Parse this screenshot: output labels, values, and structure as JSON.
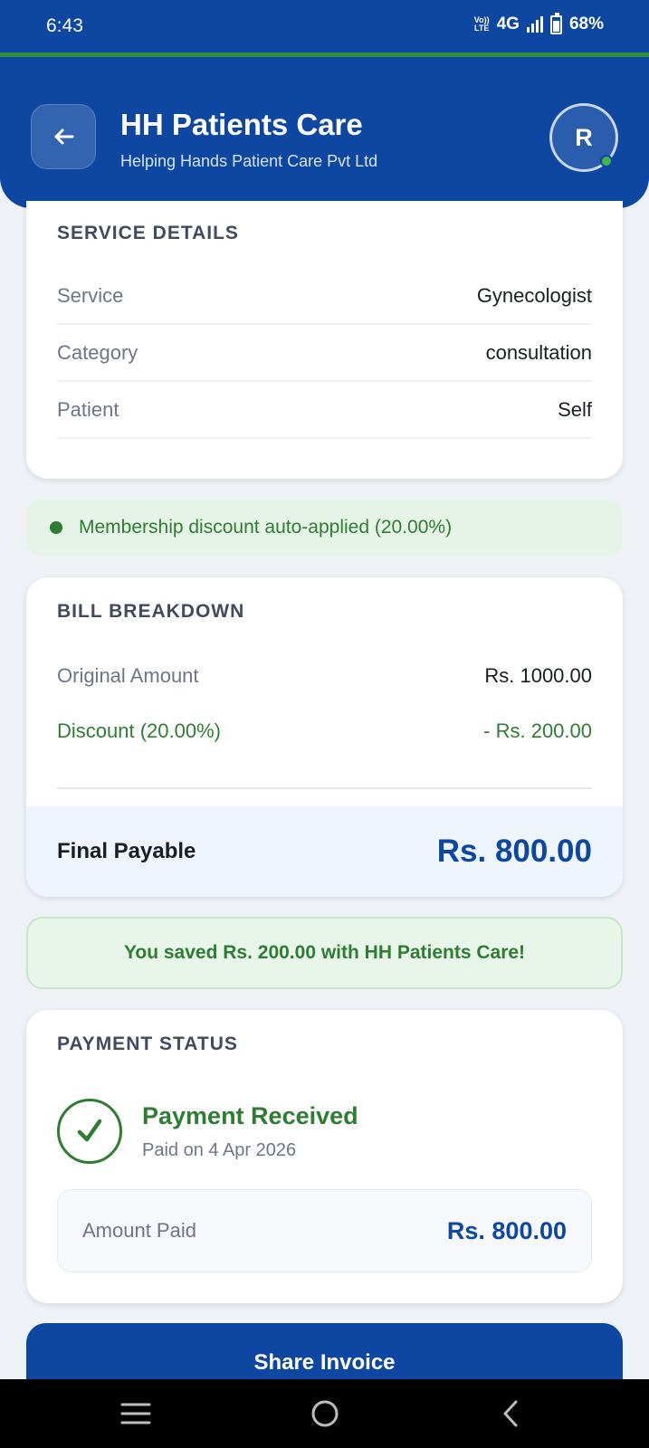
{
  "status_bar": {
    "time": "6:43",
    "volte_top": "Vo))",
    "volte_bottom": "LTE",
    "network": "4G",
    "battery": "68%",
    "battery_level": 0.68
  },
  "header": {
    "title": "HH Patients Care",
    "subtitle": "Helping Hands Patient Care Pvt Ltd",
    "avatar_initial": "R",
    "back_icon": "arrow-left-icon"
  },
  "service_details": {
    "title": "SERVICE DETAILS",
    "rows": [
      {
        "label": "Service",
        "value": "Gynecologist"
      },
      {
        "label": "Category",
        "value": "consultation"
      },
      {
        "label": "Patient",
        "value": "Self"
      }
    ]
  },
  "discount_banner": {
    "text": "Membership discount auto-applied (20.00%)"
  },
  "bill_breakdown": {
    "title": "BILL BREAKDOWN",
    "original_label": "Original Amount",
    "original_value": "Rs. 1000.00",
    "discount_label": "Discount (20.00%)",
    "discount_value": "- Rs. 200.00",
    "final_label": "Final Payable",
    "final_value": "Rs. 800.00"
  },
  "savings_banner": {
    "text": "You saved Rs. 200.00 with HH Patients Care!"
  },
  "payment_status": {
    "title": "PAYMENT STATUS",
    "status": "Payment Received",
    "paid_on": "Paid on 4 Apr 2026",
    "amount_label": "Amount Paid",
    "amount_value": "Rs. 800.00"
  },
  "actions": {
    "share_label": "Share Invoice"
  },
  "nav": {
    "icons": [
      "menu-icon",
      "home-icon",
      "back-icon"
    ]
  },
  "colors": {
    "primary": "#0d47a1",
    "success": "#2e7d32",
    "success_bg": "#e6f4e7",
    "background": "#eef1f6"
  }
}
